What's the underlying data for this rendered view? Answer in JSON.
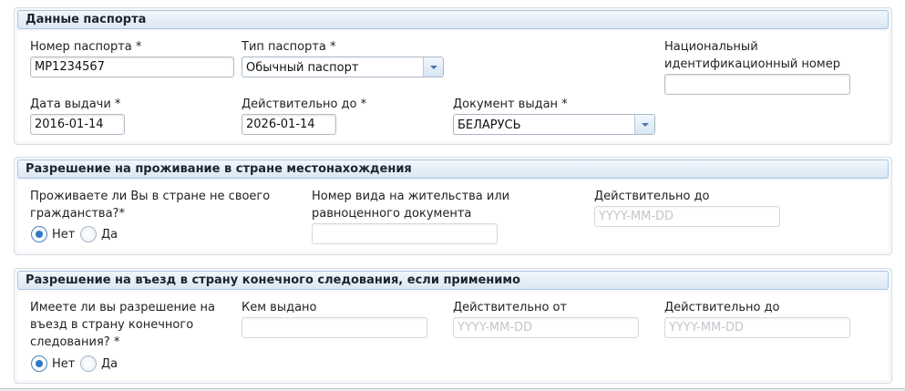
{
  "passport": {
    "title": "Данные паспорта",
    "number_label": "Номер паспорта *",
    "number_value": "MP1234567",
    "type_label": "Тип паспорта *",
    "type_value": "Обычный паспорт",
    "national_id_label_1": "Национальный",
    "national_id_label_2": "идентификационный номер",
    "national_id_value": "",
    "issue_date_label": "Дата выдачи *",
    "issue_date_value": "2016-01-14",
    "valid_until_label": "Действительно до *",
    "valid_until_value": "2026-01-14",
    "issued_by_label": "Документ выдан *",
    "issued_by_value": "БЕЛАРУСЬ"
  },
  "residence": {
    "title": "Разрешение на проживание в стране местонахождения",
    "question_line_1": "Проживаете ли Вы в стране не своего",
    "question_line_2": "гражданства?*",
    "option_no": "Нет",
    "option_yes": "Да",
    "selected": "no",
    "permit_label_1": "Номер вида на жительства или",
    "permit_label_2": "равноценного документа",
    "permit_value": "",
    "valid_until_label": "Действительно до",
    "date_placeholder": "YYYY-MM-DD"
  },
  "entry": {
    "title": "Разрешение на въезд в страну конечного следования, если применимо",
    "question_line_1": "Имеете ли вы разрешение на",
    "question_line_2": "въезд в страну конечного",
    "question_line_3": "следования? *",
    "option_no": "Нет",
    "option_yes": "Да",
    "selected": "no",
    "issued_by_label": "Кем выдано",
    "issued_by_value": "",
    "valid_from_label": "Действительно от",
    "valid_until_label": "Действительно до",
    "date_placeholder": "YYYY-MM-DD"
  },
  "colors": {
    "header_gradient_top": "#f2f7fc",
    "header_gradient_bottom": "#dbe7f4",
    "header_border": "#a9c4e0",
    "radio_selected": "#2f78c5"
  },
  "icons": {
    "select_arrow": "chevron-down-icon"
  }
}
